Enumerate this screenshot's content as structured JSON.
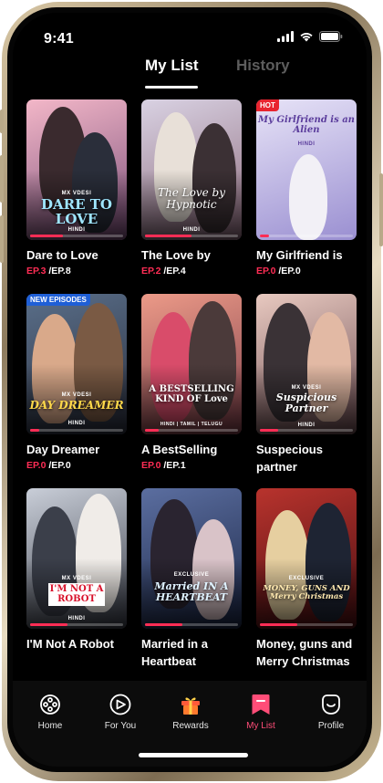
{
  "status": {
    "time": "9:41"
  },
  "tabs": [
    {
      "label": "My List",
      "active": true
    },
    {
      "label": "History",
      "active": false
    }
  ],
  "shows": [
    {
      "title": "Dare to Love",
      "ep_current": "EP.3",
      "ep_total": "/EP.8",
      "poster_text": "DARE TO LOVE",
      "poster_brand": "MX VDESI",
      "poster_lang": "HINDI",
      "badge": "",
      "progress": 0.35,
      "palette": [
        "#f3b7c8",
        "#7a4f7a"
      ]
    },
    {
      "title": "The Love by",
      "ep_current": "EP.2",
      "ep_total": "/EP.4",
      "poster_text": "The Love by Hypnotic",
      "poster_brand": "",
      "poster_lang": "HINDI",
      "badge": "",
      "progress": 0.5,
      "palette": [
        "#d9d2e3",
        "#8d6b7c"
      ]
    },
    {
      "title": "My Girlfriend is",
      "ep_current": "EP.0",
      "ep_total": "/EP.0",
      "poster_text": "My Girlfriend is an Alien",
      "poster_brand": "",
      "poster_lang": "HINDI",
      "badge": "HOT",
      "progress": 0.1,
      "palette": [
        "#e7e3f7",
        "#9a8fd1"
      ]
    },
    {
      "title": "Day Dreamer",
      "ep_current": "EP.0",
      "ep_total": "/EP.0",
      "poster_text": "DAY DREAMER",
      "poster_brand": "MX VDESI",
      "poster_lang": "HINDI",
      "badge": "NEW EPISODES",
      "progress": 0.1,
      "palette": [
        "#5a6f8a",
        "#2b2f3d"
      ]
    },
    {
      "title": "A BestSelling",
      "ep_current": "EP.0",
      "ep_total": "/EP.1",
      "poster_text": "A BESTSELLING KIND OF Love",
      "poster_brand": "",
      "poster_lang": "HINDI | TAMIL | TELUGU",
      "badge": "",
      "progress": 0.15,
      "palette": [
        "#ec9a88",
        "#7e3f4a"
      ]
    },
    {
      "title": "Suspecious partner",
      "ep_current": "",
      "ep_total": "",
      "poster_text": "Suspicious Partner",
      "poster_brand": "MX VDESI",
      "poster_lang": "HINDI",
      "badge": "",
      "progress": 0.2,
      "palette": [
        "#e8c9c0",
        "#6d4d52"
      ]
    },
    {
      "title": "I'M Not A Robot",
      "ep_current": "",
      "ep_total": "",
      "poster_text": "I'M NOT A ROBOT",
      "poster_brand": "MX VDESI",
      "poster_lang": "HINDI",
      "badge": "",
      "progress": 0.4,
      "palette": [
        "#c9ced8",
        "#3b3f4a"
      ]
    },
    {
      "title": "Married in a Heartbeat",
      "ep_current": "",
      "ep_total": "",
      "poster_text": "Married IN A HEARTBEAT",
      "poster_brand": "EXCLUSIVE",
      "poster_lang": "",
      "badge": "",
      "progress": 0.4,
      "palette": [
        "#5b6ea0",
        "#1c2746"
      ]
    },
    {
      "title": "Money, guns and Merry Christmas",
      "ep_current": "",
      "ep_total": "",
      "poster_text": "MONEY, GUNS AND Merry Christmas",
      "poster_brand": "EXCLUSIVE",
      "poster_lang": "",
      "badge": "",
      "progress": 0.4,
      "palette": [
        "#b8332d",
        "#4a0f12"
      ]
    }
  ],
  "nav": [
    {
      "label": "Home",
      "icon": "film-reel-icon",
      "active": false
    },
    {
      "label": "For You",
      "icon": "eye-icon",
      "active": false
    },
    {
      "label": "Rewards",
      "icon": "gift-icon",
      "active": false
    },
    {
      "label": "My List",
      "icon": "bookmark-icon",
      "active": true
    },
    {
      "label": "Profile",
      "icon": "profile-icon",
      "active": false
    }
  ],
  "colors": {
    "accent": "#ff2d55",
    "background": "#000000",
    "inactive_tab": "#5d5d5d"
  }
}
